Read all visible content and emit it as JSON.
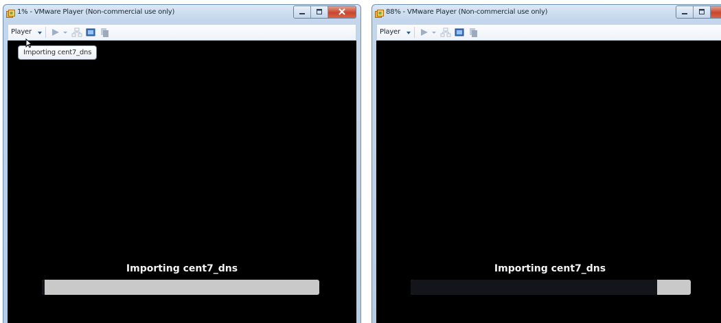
{
  "windows": [
    {
      "title": "1% - VMware Player (Non-commercial use only)",
      "menu_label": "Player",
      "import_text": "Importing cent7_dns",
      "progress": 0.01,
      "tooltip": "Importing cent7_dns"
    },
    {
      "title": "88% - VMware Player (Non-commercial use only)",
      "menu_label": "Player",
      "import_text": "Importing cent7_dns",
      "progress": 0.88
    }
  ],
  "icons": [
    "vmware-player-icon",
    "minimize-icon",
    "maximize-icon",
    "close-icon",
    "power-on-icon",
    "dropdown-icon",
    "network-icon",
    "fullscreen-icon",
    "unity-icon",
    "mouse-pointer-icon"
  ],
  "colors": {
    "title_bar": "#c3d6ec",
    "screen": "#000000",
    "progress_track": "#c9c9c9",
    "progress_fill": "#14141b",
    "close_button": "#c9452c",
    "import_text": "#f3f3f3"
  }
}
